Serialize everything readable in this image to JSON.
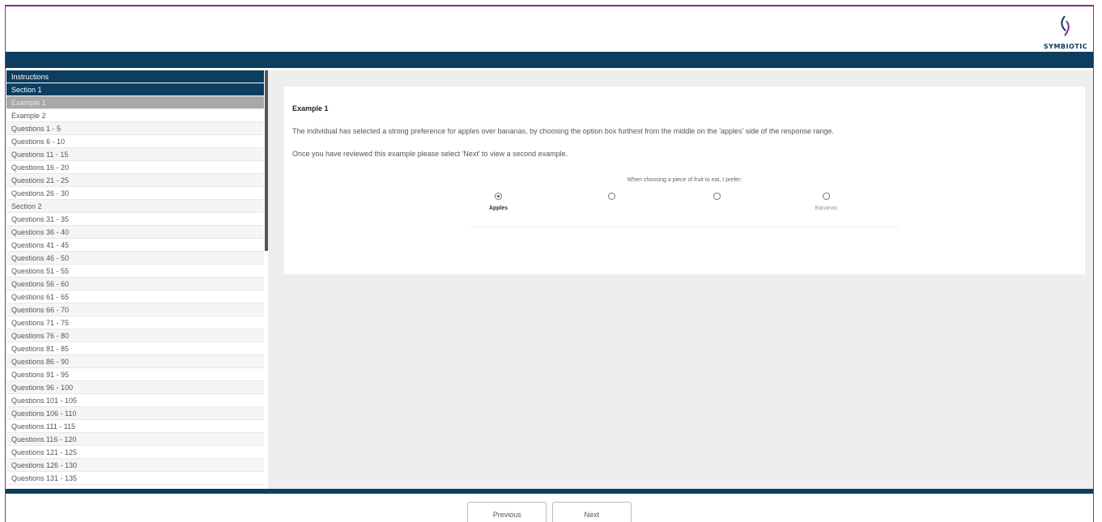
{
  "brand": {
    "logo_text": "SYMBIOTIC",
    "colors": {
      "primary": "#0d3d5f",
      "frame": "#93278f",
      "active_item": "#a8a8a8"
    }
  },
  "sidebar": {
    "items": [
      {
        "label": "Instructions",
        "type": "header"
      },
      {
        "label": "Section 1",
        "type": "header"
      },
      {
        "label": "Example 1",
        "type": "active"
      },
      {
        "label": "Example 2",
        "type": "item"
      },
      {
        "label": "Questions 1 - 5",
        "type": "item"
      },
      {
        "label": "Questions 6 - 10",
        "type": "item"
      },
      {
        "label": "Questions 11 - 15",
        "type": "item"
      },
      {
        "label": "Questions 16 - 20",
        "type": "item"
      },
      {
        "label": "Questions 21 - 25",
        "type": "item"
      },
      {
        "label": "Questions 26 - 30",
        "type": "item"
      },
      {
        "label": "Section 2",
        "type": "item"
      },
      {
        "label": "Questions 31 - 35",
        "type": "item"
      },
      {
        "label": "Questions 36 - 40",
        "type": "item"
      },
      {
        "label": "Questions 41 - 45",
        "type": "item"
      },
      {
        "label": "Questions 46 - 50",
        "type": "item"
      },
      {
        "label": "Questions 51 - 55",
        "type": "item"
      },
      {
        "label": "Questions 56 - 60",
        "type": "item"
      },
      {
        "label": "Questions 61 - 65",
        "type": "item"
      },
      {
        "label": "Questions 66 - 70",
        "type": "item"
      },
      {
        "label": "Questions 71 - 75",
        "type": "item"
      },
      {
        "label": "Questions 76 - 80",
        "type": "item"
      },
      {
        "label": "Questions 81 - 85",
        "type": "item"
      },
      {
        "label": "Questions 86 - 90",
        "type": "item"
      },
      {
        "label": "Questions 91 - 95",
        "type": "item"
      },
      {
        "label": "Questions 96 - 100",
        "type": "item"
      },
      {
        "label": "Questions 101 - 105",
        "type": "item"
      },
      {
        "label": "Questions 106 - 110",
        "type": "item"
      },
      {
        "label": "Questions 111 - 115",
        "type": "item"
      },
      {
        "label": "Questions 116 - 120",
        "type": "item"
      },
      {
        "label": "Questions 121 - 125",
        "type": "item"
      },
      {
        "label": "Questions 126 - 130",
        "type": "item"
      },
      {
        "label": "Questions 131 - 135",
        "type": "item"
      }
    ]
  },
  "main": {
    "title": "Example 1",
    "paragraphs": [
      "The individual has selected a strong preference for apples over bananas, by choosing the option box furthest from the middle on the 'apples' side of the response range.",
      "Once you have reviewed this example please select 'Next' to view a second example."
    ],
    "question": {
      "prompt": "When choosing a piece of fruit to eat, I prefer:",
      "options": [
        {
          "label": "Apples",
          "selected": true
        },
        {
          "label": "",
          "selected": false
        },
        {
          "label": "",
          "selected": false
        },
        {
          "label": "Bananas",
          "selected": false
        }
      ]
    }
  },
  "footer": {
    "previous_label": "Previous",
    "next_label": "Next"
  }
}
